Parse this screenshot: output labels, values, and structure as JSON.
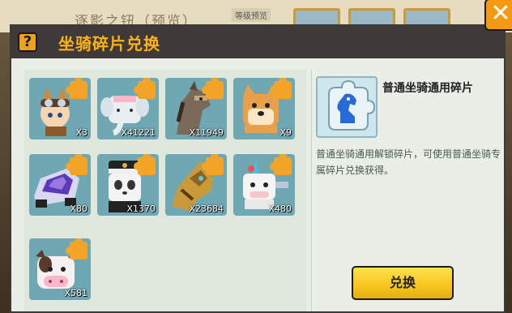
{
  "background": {
    "title": "逐影之钮（预览）",
    "tag": "等级预览"
  },
  "dialog": {
    "title": "坐骑碎片兑换",
    "help_icon": "question-icon",
    "close_icon": "close-x-icon",
    "help_label": "?",
    "close_label": "✕"
  },
  "items": [
    {
      "name": "fox-aviator-mount",
      "count": "X3",
      "bg": "#6fa7b3"
    },
    {
      "name": "elephant-mount",
      "count": "X41221",
      "bg": "#6fa7b3"
    },
    {
      "name": "horse-mount",
      "count": "X11949",
      "bg": "#6fa7b3"
    },
    {
      "name": "shiba-dog-mount",
      "count": "X9",
      "bg": "#6fa7b3"
    },
    {
      "name": "racing-car-mount",
      "count": "X80",
      "bg": "#6fa7b3"
    },
    {
      "name": "panda-captain-mount",
      "count": "X1370",
      "bg": "#6fa7b3"
    },
    {
      "name": "golden-mech-mount",
      "count": "X23684",
      "bg": "#6fa7b3"
    },
    {
      "name": "unicorn-cow-mount",
      "count": "X480",
      "bg": "#6fa7b3"
    },
    {
      "name": "cow-mount",
      "count": "X581",
      "bg": "#6fa7b3"
    }
  ],
  "detail": {
    "name": "普通坐骑通用碎片",
    "description": "普通坐骑通用解锁碎片，可使用普通坐骑专属碎片兑换获得。",
    "icon": "knight-puzzle-icon"
  },
  "exchange_button": "兑换",
  "colors": {
    "accent": "#ffb21a",
    "button": "#f7c51e",
    "tile": "#6fa7b3",
    "panel": "#e9efe6"
  }
}
